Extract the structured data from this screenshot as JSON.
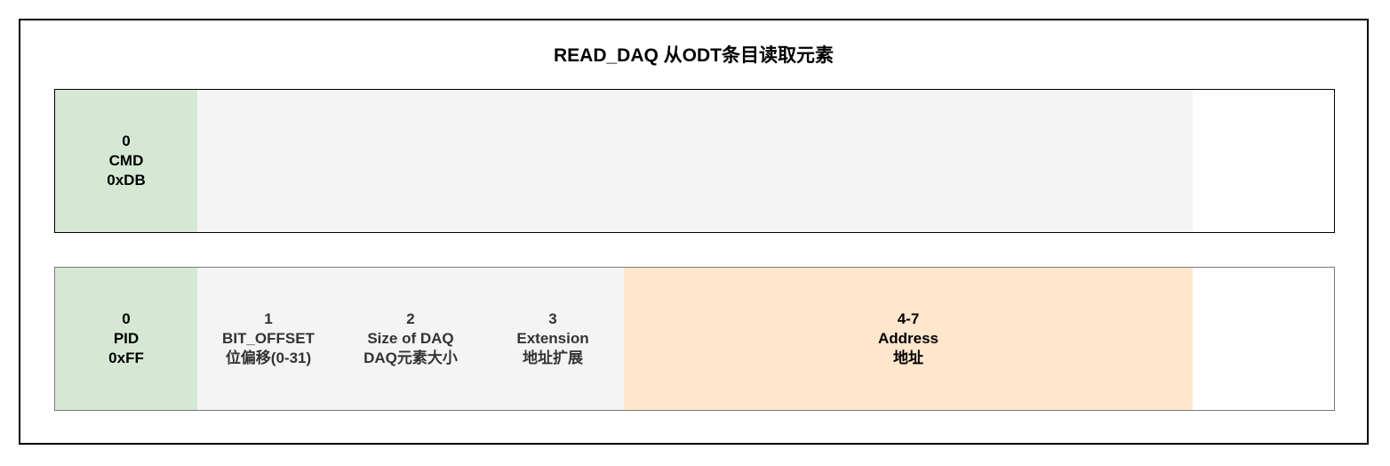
{
  "title": "READ_DAQ  从ODT条目读取元素",
  "colors": {
    "green": "#d5e8d4",
    "grey": "#f4f4f4",
    "orange": "#ffe6cc"
  },
  "command_row": {
    "cmd": {
      "index": "0",
      "name": "CMD",
      "value": "0xDB"
    }
  },
  "response_row": {
    "pid": {
      "index": "0",
      "name": "PID",
      "value": "0xFF"
    },
    "bit_offset": {
      "index": "1",
      "name": "BIT_OFFSET",
      "desc": "位偏移(0-31)"
    },
    "size": {
      "index": "2",
      "name": "Size of DAQ",
      "desc": "DAQ元素大小"
    },
    "extension": {
      "index": "3",
      "name": "Extension",
      "desc": "地址扩展"
    },
    "address": {
      "index": "4-7",
      "name": "Address",
      "desc": "地址"
    }
  }
}
